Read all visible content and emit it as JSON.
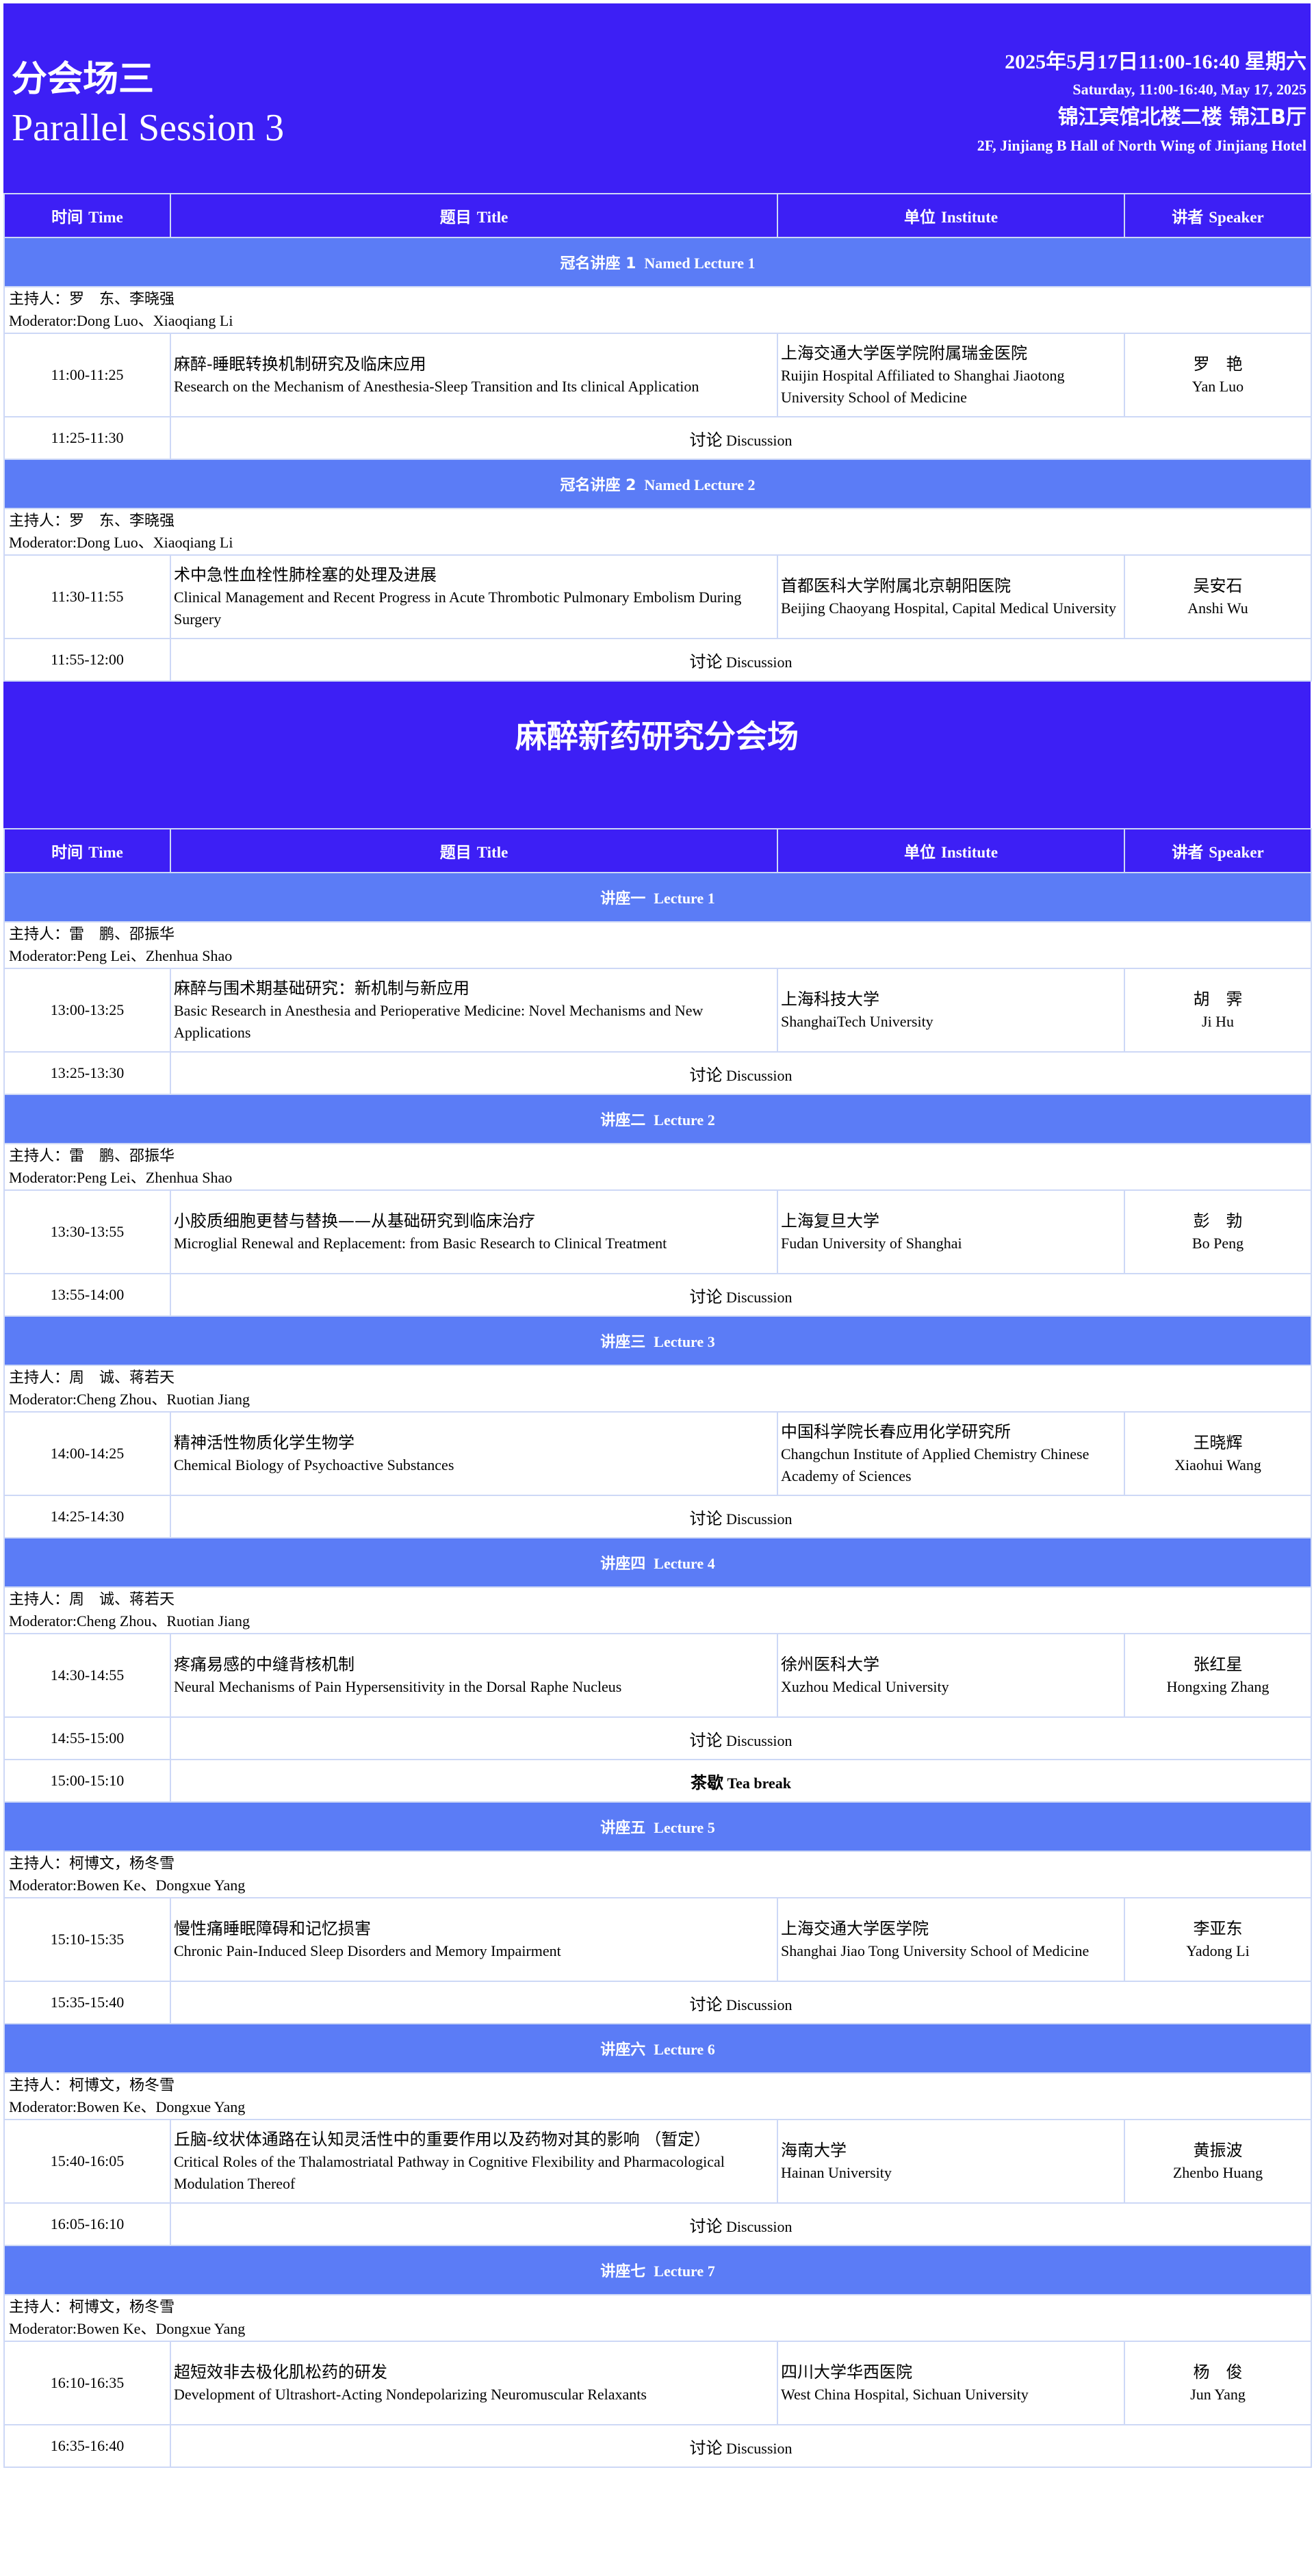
{
  "header": {
    "session_cn": "分会场三",
    "session_en": "Parallel Session 3",
    "date_cn": "2025年5月17日11:00-16:40  星期六",
    "date_en": "Saturday, 11:00-16:40, May 17, 2025",
    "venue_cn": "锦江宾馆北楼二楼 锦江B厅",
    "venue_en": "2F, Jinjiang B Hall of North Wing of Jinjiang Hotel"
  },
  "columns": [
    {
      "cn": "时间",
      "en": "Time"
    },
    {
      "cn": "题目",
      "en": "Title"
    },
    {
      "cn": "单位",
      "en": "Institute"
    },
    {
      "cn": "讲者",
      "en": "Speaker"
    }
  ],
  "part1": {
    "blocks": [
      {
        "lecture_cn": "冠名讲座 1",
        "lecture_en": "Named Lecture 1",
        "moderator_cn": "主持人：罗　东、李晓强",
        "moderator_en": "Moderator:Dong Luo、Xiaoqiang Li",
        "talk": {
          "time": "11:00-11:25",
          "title_cn": "麻醉-睡眠转换机制研究及临床应用",
          "title_en": "Research on the Mechanism of Anesthesia-Sleep Transition and Its clinical Application",
          "inst_cn": "上海交通大学医学院附属瑞金医院",
          "inst_en": "Ruijin Hospital Affiliated to Shanghai Jiaotong University School of Medicine",
          "speaker_cn": "罗　艳",
          "speaker_en": "Yan Luo"
        },
        "discussion": {
          "time": "11:25-11:30",
          "cn": "讨论",
          "en": "Discussion"
        }
      },
      {
        "lecture_cn": "冠名讲座 2",
        "lecture_en": "Named Lecture 2",
        "moderator_cn": "主持人：罗　东、李晓强",
        "moderator_en": "Moderator:Dong Luo、Xiaoqiang Li",
        "talk": {
          "time": "11:30-11:55",
          "title_cn": "术中急性血栓性肺栓塞的处理及进展",
          "title_en": "Clinical Management and Recent Progress in Acute Thrombotic Pulmonary Embolism During Surgery",
          "inst_cn": "首都医科大学附属北京朝阳医院",
          "inst_en": "Beijing Chaoyang Hospital, Capital Medical University",
          "speaker_cn": "吴安石",
          "speaker_en": "Anshi Wu"
        },
        "discussion": {
          "time": "11:55-12:00",
          "cn": "讨论",
          "en": "Discussion"
        }
      }
    ]
  },
  "section2_title": "麻醉新药研究分会场",
  "part2": {
    "blocks": [
      {
        "lecture_cn": "讲座一",
        "lecture_en": "Lecture 1",
        "moderator_cn": "主持人：雷　鹏、邵振华",
        "moderator_en": "Moderator:Peng Lei、Zhenhua Shao",
        "talk": {
          "time": "13:00-13:25",
          "title_cn": "麻醉与围术期基础研究：新机制与新应用",
          "title_en": "Basic Research in Anesthesia and Perioperative Medicine: Novel Mechanisms and New Applications",
          "inst_cn": "上海科技大学",
          "inst_en": "ShanghaiTech University",
          "speaker_cn": "胡　霁",
          "speaker_en": "Ji Hu"
        },
        "discussion": {
          "time": "13:25-13:30",
          "cn": "讨论",
          "en": "Discussion"
        }
      },
      {
        "lecture_cn": "讲座二",
        "lecture_en": "Lecture 2",
        "moderator_cn": "主持人：雷　鹏、邵振华",
        "moderator_en": "Moderator:Peng Lei、Zhenhua Shao",
        "talk": {
          "time": "13:30-13:55",
          "title_cn": "小胶质细胞更替与替换——从基础研究到临床治疗",
          "title_en": "Microglial Renewal and Replacement: from Basic Research to Clinical Treatment",
          "inst_cn": "上海复旦大学",
          "inst_en": "Fudan University of Shanghai",
          "speaker_cn": "彭　勃",
          "speaker_en": "Bo Peng"
        },
        "discussion": {
          "time": "13:55-14:00",
          "cn": "讨论",
          "en": "Discussion"
        }
      },
      {
        "lecture_cn": "讲座三",
        "lecture_en": "Lecture 3",
        "moderator_cn": "主持人：周　诚、蒋若天",
        "moderator_en": "Moderator:Cheng Zhou、Ruotian Jiang",
        "talk": {
          "time": "14:00-14:25",
          "title_cn": "精神活性物质化学生物学",
          "title_en": "Chemical Biology of Psychoactive Substances",
          "inst_cn": "中国科学院长春应用化学研究所",
          "inst_en": "Changchun Institute of Applied Chemistry Chinese Academy of Sciences",
          "speaker_cn": "王晓辉",
          "speaker_en": "Xiaohui Wang"
        },
        "discussion": {
          "time": "14:25-14:30",
          "cn": "讨论",
          "en": "Discussion"
        }
      },
      {
        "lecture_cn": "讲座四",
        "lecture_en": "Lecture 4",
        "moderator_cn": "主持人：周　诚、蒋若天",
        "moderator_en": "Moderator:Cheng Zhou、Ruotian Jiang",
        "talk": {
          "time": "14:30-14:55",
          "title_cn": "疼痛易感的中缝背核机制",
          "title_en": "Neural Mechanisms of Pain Hypersensitivity in the Dorsal Raphe Nucleus",
          "inst_cn": "徐州医科大学",
          "inst_en": "Xuzhou Medical University",
          "speaker_cn": "张红星",
          "speaker_en": "Hongxing Zhang"
        },
        "discussion": {
          "time": "14:55-15:00",
          "cn": "讨论",
          "en": "Discussion"
        },
        "tea": {
          "time": "15:00-15:10",
          "cn": "茶歇",
          "en": "Tea break"
        }
      },
      {
        "lecture_cn": "讲座五",
        "lecture_en": "Lecture 5",
        "moderator_cn": "主持人：柯博文，杨冬雪",
        "moderator_en": "Moderator:Bowen Ke、Dongxue Yang",
        "talk": {
          "time": "15:10-15:35",
          "title_cn": "慢性痛睡眠障碍和记忆损害",
          "title_en": "Chronic Pain-Induced Sleep Disorders and Memory Impairment",
          "inst_cn": "上海交通大学医学院",
          "inst_en": "Shanghai Jiao Tong University School of Medicine",
          "speaker_cn": "李亚东",
          "speaker_en": "Yadong Li"
        },
        "discussion": {
          "time": "15:35-15:40",
          "cn": "讨论",
          "en": "Discussion"
        }
      },
      {
        "lecture_cn": "讲座六",
        "lecture_en": "Lecture 6",
        "moderator_cn": "主持人：柯博文，杨冬雪",
        "moderator_en": "Moderator:Bowen Ke、Dongxue Yang",
        "talk": {
          "time": "15:40-16:05",
          "title_cn": "丘脑-纹状体通路在认知灵活性中的重要作用以及药物对其的影响 （暂定）",
          "title_en": "Critical Roles of the Thalamostriatal Pathway in Cognitive Flexibility and Pharmacological Modulation Thereof",
          "inst_cn": "海南大学",
          "inst_en": "Hainan University",
          "speaker_cn": "黄振波",
          "speaker_en": "Zhenbo Huang"
        },
        "discussion": {
          "time": "16:05-16:10",
          "cn": "讨论",
          "en": "Discussion"
        }
      },
      {
        "lecture_cn": "讲座七",
        "lecture_en": "Lecture 7",
        "moderator_cn": "主持人：柯博文，杨冬雪",
        "moderator_en": "Moderator:Bowen Ke、Dongxue Yang",
        "talk": {
          "time": "16:10-16:35",
          "title_cn": "超短效非去极化肌松药的研发",
          "title_en": "Development of Ultrashort-Acting Nondepolarizing Neuromuscular Relaxants",
          "inst_cn": "四川大学华西医院",
          "inst_en": "West China Hospital, Sichuan University",
          "speaker_cn": "杨　俊",
          "speaker_en": "Jun Yang"
        },
        "discussion": {
          "time": "16:35-16:40",
          "cn": "讨论",
          "en": "Discussion"
        }
      }
    ]
  }
}
